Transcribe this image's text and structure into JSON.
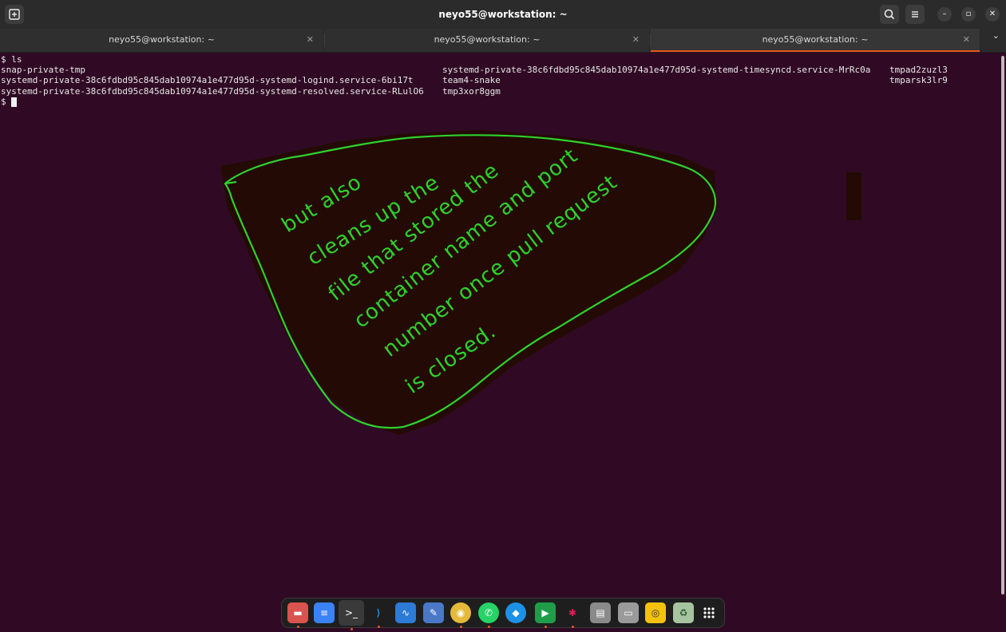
{
  "window": {
    "title": "neyo55@workstation: ~",
    "new_tab_icon": "new-tab-icon",
    "search_icon": "search-icon",
    "menu_icon": "hamburger-menu-icon",
    "minimize_glyph": "–",
    "maximize_glyph": "▫",
    "close_glyph": "✕"
  },
  "tabs": [
    {
      "label": "neyo55@workstation: ~",
      "close": "✕",
      "active": false
    },
    {
      "label": "neyo55@workstation: ~",
      "close": "✕",
      "active": false
    },
    {
      "label": "neyo55@workstation: ~",
      "close": "✕",
      "active": true
    }
  ],
  "tab_menu_glyph": "⌄",
  "terminal": {
    "command": "$ ls",
    "col1": [
      "snap-private-tmp",
      "systemd-private-38c6fdbd95c845dab10974a1e477d95d-systemd-logind.service-6bi17t",
      "systemd-private-38c6fdbd95c845dab10974a1e477d95d-systemd-resolved.service-RLulO6"
    ],
    "col2": [
      "systemd-private-38c6fdbd95c845dab10974a1e477d95d-systemd-timesyncd.service-MrRc0a",
      "team4-snake",
      "tmp3xor8ggm"
    ],
    "col3": [
      "tmpad2zuzl3",
      "tmparsk3lr9"
    ],
    "prompt": "$"
  },
  "annotation": {
    "lines": [
      "but also",
      "cleans up the",
      "file that stored the",
      "container name and port",
      "number once pull request",
      "is closed."
    ],
    "ink_color": "#2ed12e",
    "fill_color": "#230a04"
  },
  "dock": {
    "items": [
      {
        "icon": "files-icon",
        "color": "#d9534f",
        "glyph": "▬"
      },
      {
        "icon": "text-editor-icon",
        "color": "#3b82f6",
        "glyph": "≡"
      },
      {
        "icon": "terminal-icon",
        "color": "#2b2b2b",
        "glyph": ">_"
      },
      {
        "icon": "vscode-icon",
        "color": "#1e88e5",
        "glyph": "⟩"
      },
      {
        "icon": "system-monitor-icon",
        "color": "#2c7bd6",
        "glyph": "∿"
      },
      {
        "icon": "notes-icon",
        "color": "#4a78c7",
        "glyph": "✎"
      },
      {
        "icon": "chrome-icon",
        "color": "#e5b93a",
        "glyph": "◉"
      },
      {
        "icon": "whatsapp-icon",
        "color": "#25d366",
        "glyph": "✆"
      },
      {
        "icon": "docker-icon",
        "color": "#1d91e6",
        "glyph": "◆"
      },
      {
        "icon": "google-meet-icon",
        "color": "#1f9e4a",
        "glyph": "▶"
      },
      {
        "icon": "slack-icon",
        "color": "#e01e5a",
        "glyph": "✱"
      },
      {
        "icon": "disk-icon",
        "color": "#8a8a8a",
        "glyph": "▤"
      },
      {
        "icon": "drive-icon",
        "color": "#9a9a9a",
        "glyph": "▭"
      },
      {
        "icon": "yellow-app-icon",
        "color": "#f4c20d",
        "glyph": "◎"
      },
      {
        "icon": "trash-icon",
        "color": "#a7c4a0",
        "glyph": "♻"
      },
      {
        "icon": "app-grid-icon",
        "color": "#1e1e1e",
        "glyph": "⋮⋮⋮"
      }
    ]
  }
}
